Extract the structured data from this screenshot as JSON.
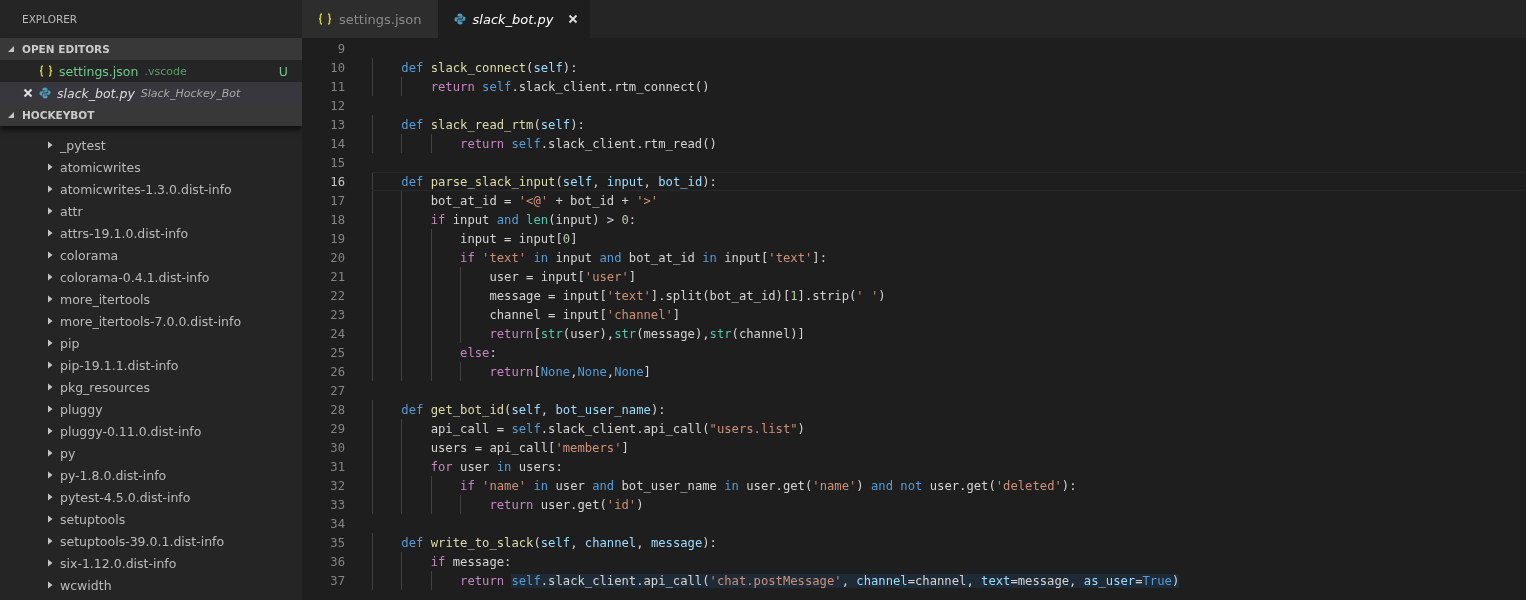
{
  "sidebar": {
    "title": "EXPLORER",
    "open_editors": {
      "title": "OPEN EDITORS",
      "expanded": true,
      "items": [
        {
          "name": "settings.json",
          "description": ".vscode",
          "kind": "json",
          "badge": "U",
          "selected": false,
          "preview": false,
          "modified_untracked": true
        },
        {
          "name": "slack_bot.py",
          "description": "Slack_Hockey_Bot",
          "kind": "python",
          "selected": true,
          "preview": true,
          "modified_untracked": false
        }
      ]
    },
    "folder": {
      "title": "HOCKEYBOT",
      "expanded": true,
      "items": [
        {
          "name": "_pytest",
          "expanded": false
        },
        {
          "name": "atomicwrites",
          "expanded": false
        },
        {
          "name": "atomicwrites-1.3.0.dist-info",
          "expanded": false
        },
        {
          "name": "attr",
          "expanded": false
        },
        {
          "name": "attrs-19.1.0.dist-info",
          "expanded": false
        },
        {
          "name": "colorama",
          "expanded": false
        },
        {
          "name": "colorama-0.4.1.dist-info",
          "expanded": false
        },
        {
          "name": "more_itertools",
          "expanded": false
        },
        {
          "name": "more_itertools-7.0.0.dist-info",
          "expanded": false
        },
        {
          "name": "pip",
          "expanded": false
        },
        {
          "name": "pip-19.1.1.dist-info",
          "expanded": false
        },
        {
          "name": "pkg_resources",
          "expanded": false
        },
        {
          "name": "pluggy",
          "expanded": false
        },
        {
          "name": "pluggy-0.11.0.dist-info",
          "expanded": false
        },
        {
          "name": "py",
          "expanded": false
        },
        {
          "name": "py-1.8.0.dist-info",
          "expanded": false
        },
        {
          "name": "pytest-4.5.0.dist-info",
          "expanded": false
        },
        {
          "name": "setuptools",
          "expanded": false
        },
        {
          "name": "setuptools-39.0.1.dist-info",
          "expanded": false
        },
        {
          "name": "six-1.12.0.dist-info",
          "expanded": false
        },
        {
          "name": "wcwidth",
          "expanded": false
        }
      ]
    }
  },
  "tabs": [
    {
      "label": "settings.json",
      "kind": "json",
      "selected": false,
      "preview": false
    },
    {
      "label": "slack_bot.py",
      "kind": "python",
      "selected": true,
      "preview": true
    }
  ],
  "editor": {
    "lines": [
      {
        "number": "9",
        "current": false
      },
      {
        "number": "10",
        "current": false,
        "tokens": [
          {
            "kind": "keyword",
            "text": "    def"
          },
          {
            "kind": "function",
            "text": " slack_connect"
          },
          {
            "kind": "plain",
            "text": "("
          },
          {
            "kind": "parameter",
            "text": "self"
          },
          {
            "kind": "plain",
            "text": "):"
          }
        ]
      },
      {
        "number": "11",
        "current": false,
        "tokens": [
          {
            "kind": "control",
            "text": "        return"
          },
          {
            "kind": "keyword",
            "text": " self"
          },
          {
            "kind": "plain",
            "text": ".slack_client.rtm_connect()"
          }
        ]
      },
      {
        "number": "12",
        "current": false
      },
      {
        "number": "13",
        "current": false,
        "tokens": [
          {
            "kind": "keyword",
            "text": "    def"
          },
          {
            "kind": "function",
            "text": " slack_read_rtm"
          },
          {
            "kind": "plain",
            "text": "("
          },
          {
            "kind": "parameter",
            "text": "self"
          },
          {
            "kind": "plain",
            "text": "):"
          }
        ]
      },
      {
        "number": "14",
        "current": false,
        "tokens": [
          {
            "kind": "control",
            "text": "            return"
          },
          {
            "kind": "keyword",
            "text": " self"
          },
          {
            "kind": "plain",
            "text": ".slack_client.rtm_read()"
          }
        ]
      },
      {
        "number": "15",
        "current": false
      },
      {
        "number": "16",
        "current": true,
        "tokens": [
          {
            "kind": "keyword",
            "text": "    def"
          },
          {
            "kind": "function",
            "text": " parse_slack_input"
          },
          {
            "kind": "plain",
            "text": "("
          },
          {
            "kind": "parameter",
            "text": "self"
          },
          {
            "kind": "plain",
            "text": ", "
          },
          {
            "kind": "parameter",
            "text": "input"
          },
          {
            "kind": "plain",
            "text": ", "
          },
          {
            "kind": "parameter",
            "text": "bot_id"
          },
          {
            "kind": "plain",
            "text": "):"
          }
        ]
      },
      {
        "number": "17",
        "current": false,
        "tokens": [
          {
            "kind": "plain",
            "text": "        bot_at_id = "
          },
          {
            "kind": "string",
            "text": "'<@'"
          },
          {
            "kind": "plain",
            "text": " + bot_id + "
          },
          {
            "kind": "string",
            "text": "'>'"
          }
        ]
      },
      {
        "number": "18",
        "current": false,
        "tokens": [
          {
            "kind": "control",
            "text": "        if"
          },
          {
            "kind": "plain",
            "text": " input "
          },
          {
            "kind": "keyword",
            "text": "and"
          },
          {
            "kind": "builtin",
            "text": " len"
          },
          {
            "kind": "plain",
            "text": "(input) > "
          },
          {
            "kind": "number",
            "text": "0"
          },
          {
            "kind": "plain",
            "text": ":"
          }
        ]
      },
      {
        "number": "19",
        "current": false,
        "tokens": [
          {
            "kind": "plain",
            "text": "            input = input["
          },
          {
            "kind": "number",
            "text": "0"
          },
          {
            "kind": "plain",
            "text": "]"
          }
        ]
      },
      {
        "number": "20",
        "current": false,
        "tokens": [
          {
            "kind": "control",
            "text": "            if"
          },
          {
            "kind": "string",
            "text": " 'text'"
          },
          {
            "kind": "keyword",
            "text": " in"
          },
          {
            "kind": "plain",
            "text": " input "
          },
          {
            "kind": "keyword",
            "text": "and"
          },
          {
            "kind": "plain",
            "text": " bot_at_id "
          },
          {
            "kind": "keyword",
            "text": "in"
          },
          {
            "kind": "plain",
            "text": " input["
          },
          {
            "kind": "string",
            "text": "'text'"
          },
          {
            "kind": "plain",
            "text": "]:"
          }
        ]
      },
      {
        "number": "21",
        "current": false,
        "tokens": [
          {
            "kind": "plain",
            "text": "                user = input["
          },
          {
            "kind": "string",
            "text": "'user'"
          },
          {
            "kind": "plain",
            "text": "]"
          }
        ]
      },
      {
        "number": "22",
        "current": false,
        "tokens": [
          {
            "kind": "plain",
            "text": "                message = input["
          },
          {
            "kind": "string",
            "text": "'text'"
          },
          {
            "kind": "plain",
            "text": "].split(bot_at_id)["
          },
          {
            "kind": "number",
            "text": "1"
          },
          {
            "kind": "plain",
            "text": "].strip("
          },
          {
            "kind": "string",
            "text": "' '"
          },
          {
            "kind": "plain",
            "text": ")"
          }
        ]
      },
      {
        "number": "23",
        "current": false,
        "tokens": [
          {
            "kind": "plain",
            "text": "                channel = input["
          },
          {
            "kind": "string",
            "text": "'channel'"
          },
          {
            "kind": "plain",
            "text": "]"
          }
        ]
      },
      {
        "number": "24",
        "current": false,
        "tokens": [
          {
            "kind": "control",
            "text": "                return"
          },
          {
            "kind": "plain",
            "text": "["
          },
          {
            "kind": "builtin",
            "text": "str"
          },
          {
            "kind": "plain",
            "text": "(user),"
          },
          {
            "kind": "builtin",
            "text": "str"
          },
          {
            "kind": "plain",
            "text": "(message),"
          },
          {
            "kind": "builtin",
            "text": "str"
          },
          {
            "kind": "plain",
            "text": "(channel)]"
          }
        ]
      },
      {
        "number": "25",
        "current": false,
        "tokens": [
          {
            "kind": "control",
            "text": "            else"
          },
          {
            "kind": "plain",
            "text": ":"
          }
        ]
      },
      {
        "number": "26",
        "current": false,
        "tokens": [
          {
            "kind": "control",
            "text": "                return"
          },
          {
            "kind": "plain",
            "text": "["
          },
          {
            "kind": "keyword",
            "text": "None"
          },
          {
            "kind": "plain",
            "text": ","
          },
          {
            "kind": "keyword",
            "text": "None"
          },
          {
            "kind": "plain",
            "text": ","
          },
          {
            "kind": "keyword",
            "text": "None"
          },
          {
            "kind": "plain",
            "text": "]"
          }
        ]
      },
      {
        "number": "27",
        "current": false
      },
      {
        "number": "28",
        "current": false,
        "tokens": [
          {
            "kind": "keyword",
            "text": "    def"
          },
          {
            "kind": "function",
            "text": " get_bot_id"
          },
          {
            "kind": "plain",
            "text": "("
          },
          {
            "kind": "parameter",
            "text": "self"
          },
          {
            "kind": "plain",
            "text": ", "
          },
          {
            "kind": "parameter",
            "text": "bot_user_name"
          },
          {
            "kind": "plain",
            "text": "):"
          }
        ]
      },
      {
        "number": "29",
        "current": false,
        "tokens": [
          {
            "kind": "plain",
            "text": "        api_call = "
          },
          {
            "kind": "keyword",
            "text": "self"
          },
          {
            "kind": "plain",
            "text": ".slack_client.api_call("
          },
          {
            "kind": "string",
            "text": "\"users.list\""
          },
          {
            "kind": "plain",
            "text": ")"
          }
        ]
      },
      {
        "number": "30",
        "current": false,
        "tokens": [
          {
            "kind": "plain",
            "text": "        users = api_call["
          },
          {
            "kind": "string",
            "text": "'members'"
          },
          {
            "kind": "plain",
            "text": "]"
          }
        ]
      },
      {
        "number": "31",
        "current": false,
        "tokens": [
          {
            "kind": "control",
            "text": "        for"
          },
          {
            "kind": "plain",
            "text": " user "
          },
          {
            "kind": "keyword",
            "text": "in"
          },
          {
            "kind": "plain",
            "text": " users:"
          }
        ]
      },
      {
        "number": "32",
        "current": false,
        "tokens": [
          {
            "kind": "control",
            "text": "            if"
          },
          {
            "kind": "string",
            "text": " 'name'"
          },
          {
            "kind": "keyword",
            "text": " in"
          },
          {
            "kind": "plain",
            "text": " user "
          },
          {
            "kind": "keyword",
            "text": "and"
          },
          {
            "kind": "plain",
            "text": " bot_user_name "
          },
          {
            "kind": "keyword",
            "text": "in"
          },
          {
            "kind": "plain",
            "text": " user.get("
          },
          {
            "kind": "string",
            "text": "'name'"
          },
          {
            "kind": "plain",
            "text": ") "
          },
          {
            "kind": "keyword",
            "text": "and not"
          },
          {
            "kind": "plain",
            "text": " user.get("
          },
          {
            "kind": "string",
            "text": "'deleted'"
          },
          {
            "kind": "plain",
            "text": "):"
          }
        ]
      },
      {
        "number": "33",
        "current": false,
        "tokens": [
          {
            "kind": "control",
            "text": "                return"
          },
          {
            "kind": "plain",
            "text": " user.get("
          },
          {
            "kind": "string",
            "text": "'id'"
          },
          {
            "kind": "plain",
            "text": ")"
          }
        ]
      },
      {
        "number": "34",
        "current": false
      },
      {
        "number": "35",
        "current": false,
        "tokens": [
          {
            "kind": "keyword",
            "text": "    def"
          },
          {
            "kind": "function",
            "text": " write_to_slack"
          },
          {
            "kind": "plain",
            "text": "("
          },
          {
            "kind": "parameter",
            "text": "self"
          },
          {
            "kind": "plain",
            "text": ", "
          },
          {
            "kind": "parameter",
            "text": "channel"
          },
          {
            "kind": "plain",
            "text": ", "
          },
          {
            "kind": "parameter",
            "text": "message"
          },
          {
            "kind": "plain",
            "text": "):"
          }
        ]
      },
      {
        "number": "36",
        "current": false,
        "tokens": [
          {
            "kind": "control",
            "text": "        if"
          },
          {
            "kind": "plain",
            "text": " message:"
          }
        ]
      },
      {
        "number": "37",
        "current": false,
        "tokens": [
          {
            "kind": "control",
            "text": "            return "
          }
        ],
        "selected_tokens": [
          {
            "kind": "keyword",
            "text": "self"
          },
          {
            "kind": "plain",
            "text": ".slack_client.api_call("
          },
          {
            "kind": "string",
            "text": "'chat.postMessage'"
          },
          {
            "kind": "plain",
            "text": ", "
          },
          {
            "kind": "parameter",
            "text": "channel"
          },
          {
            "kind": "plain",
            "text": "=channel, "
          },
          {
            "kind": "parameter",
            "text": "text"
          },
          {
            "kind": "plain",
            "text": "=message, "
          },
          {
            "kind": "parameter",
            "text": "as_user"
          },
          {
            "kind": "plain",
            "text": "="
          },
          {
            "kind": "keyword",
            "text": "True"
          },
          {
            "kind": "plain",
            "text": ")"
          }
        ]
      }
    ]
  }
}
